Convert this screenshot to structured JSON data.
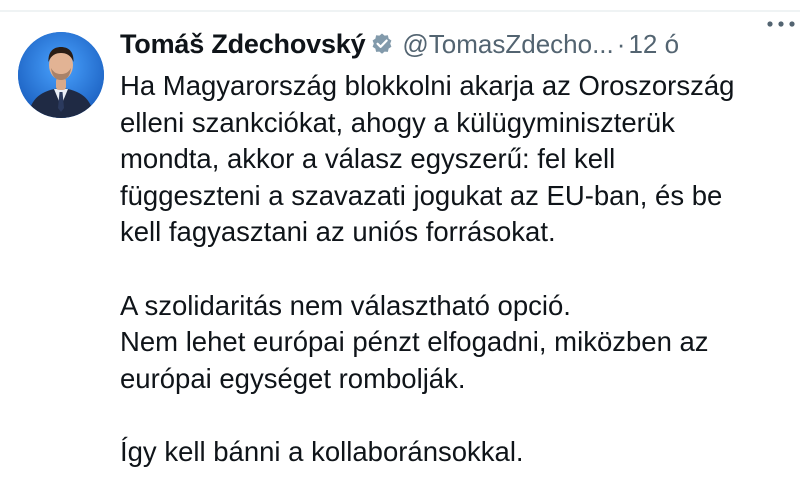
{
  "tweet": {
    "author": {
      "display_name": "Tomáš Zdechovský",
      "handle": "@TomasZdecho...",
      "verified": true,
      "avatar_icon": "user-avatar"
    },
    "separator": "·",
    "timestamp": "12 ó",
    "more_icon": "more-icon",
    "paragraphs": [
      "Ha Magyarország blokkolni akarja az Oroszország\nelleni szankciókat, ahogy a külügyminiszterük\nmondta, akkor a válasz egyszerű: fel kell\nfüggeszteni a szavazati jogukat az EU-ban, és be\nkell fagyasztani az uniós forrásokat.",
      "A szolidaritás nem választható opció.\nNem lehet európai pénzt elfogadni, miközben az\neurópai egységet rombolják.",
      "Így kell bánni a kollaboránsokkal."
    ]
  },
  "colors": {
    "text": "#0f1419",
    "secondary": "#536471",
    "verified_badge": "#829aab",
    "avatar_bg": "#1e6fd0"
  }
}
